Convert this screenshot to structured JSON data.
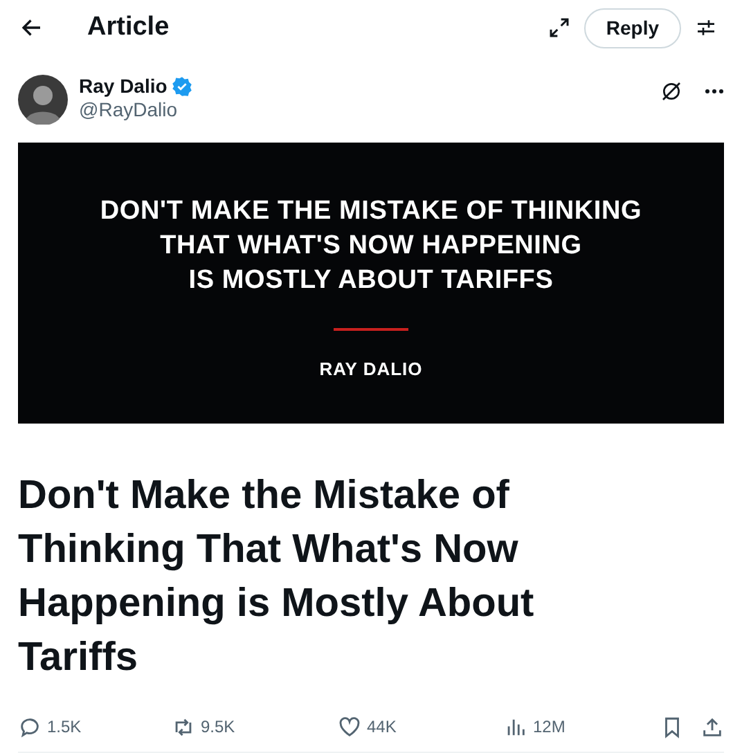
{
  "header": {
    "title": "Article",
    "reply_button": "Reply"
  },
  "author": {
    "name": "Ray Dalio",
    "handle": "@RayDalio",
    "verified": true
  },
  "cover": {
    "headline": [
      "DON'T MAKE THE MISTAKE OF THINKING",
      "THAT WHAT'S NOW HAPPENING",
      "IS MOSTLY ABOUT TARIFFS"
    ],
    "byline": "RAY DALIO"
  },
  "article_title": "Don't Make the Mistake of Thinking That What's Now Happening is Mostly About Tariffs",
  "actions": [
    {
      "kind": "reply",
      "count": "1.5K"
    },
    {
      "kind": "repost",
      "count": "9.5K"
    },
    {
      "kind": "like",
      "count": "44K"
    },
    {
      "kind": "views",
      "count": "12M"
    }
  ]
}
